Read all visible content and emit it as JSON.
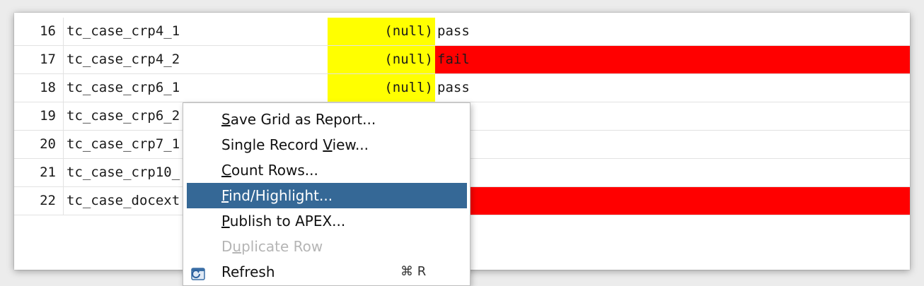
{
  "grid": {
    "rows": [
      {
        "num": "16",
        "name": "tc_case_crp4_1",
        "value": "(null)",
        "result": "pass",
        "status": "pass"
      },
      {
        "num": "17",
        "name": "tc_case_crp4_2",
        "value": "(null)",
        "result": "fail",
        "status": "fail"
      },
      {
        "num": "18",
        "name": "tc_case_crp6_1",
        "value": "(null)",
        "result": "pass",
        "status": "pass"
      },
      {
        "num": "19",
        "name": "tc_case_crp6_2",
        "value": "",
        "result": "",
        "status": "unknown"
      },
      {
        "num": "20",
        "name": "tc_case_crp7_1",
        "value": "",
        "result": "",
        "status": "unknown"
      },
      {
        "num": "21",
        "name": "tc_case_crp10_",
        "value": "",
        "result": "",
        "status": "unknown"
      },
      {
        "num": "22",
        "name": "tc_case_docext",
        "value": "",
        "result": "",
        "status": "fail"
      }
    ]
  },
  "context_menu": {
    "items": [
      {
        "pre": "",
        "ul": "S",
        "post": "ave Grid as Report...",
        "state": "normal"
      },
      {
        "pre": "Single Record ",
        "ul": "V",
        "post": "iew...",
        "state": "normal"
      },
      {
        "pre": "",
        "ul": "C",
        "post": "ount Rows...",
        "state": "normal"
      },
      {
        "pre": "",
        "ul": "F",
        "post": "ind/Highlight...",
        "state": "highlighted"
      },
      {
        "pre": "",
        "ul": "P",
        "post": "ublish to APEX...",
        "state": "normal"
      },
      {
        "pre": "D",
        "ul": "u",
        "post": "plicate Row",
        "state": "disabled"
      },
      {
        "pre": "",
        "ul": "",
        "post": "Refresh",
        "state": "normal",
        "icon": "refresh-icon",
        "shortcut": "⌘ R"
      }
    ]
  },
  "colors": {
    "null_highlight": "#ffff00",
    "fail_highlight": "#ff0000",
    "menu_selection": "#356896"
  }
}
